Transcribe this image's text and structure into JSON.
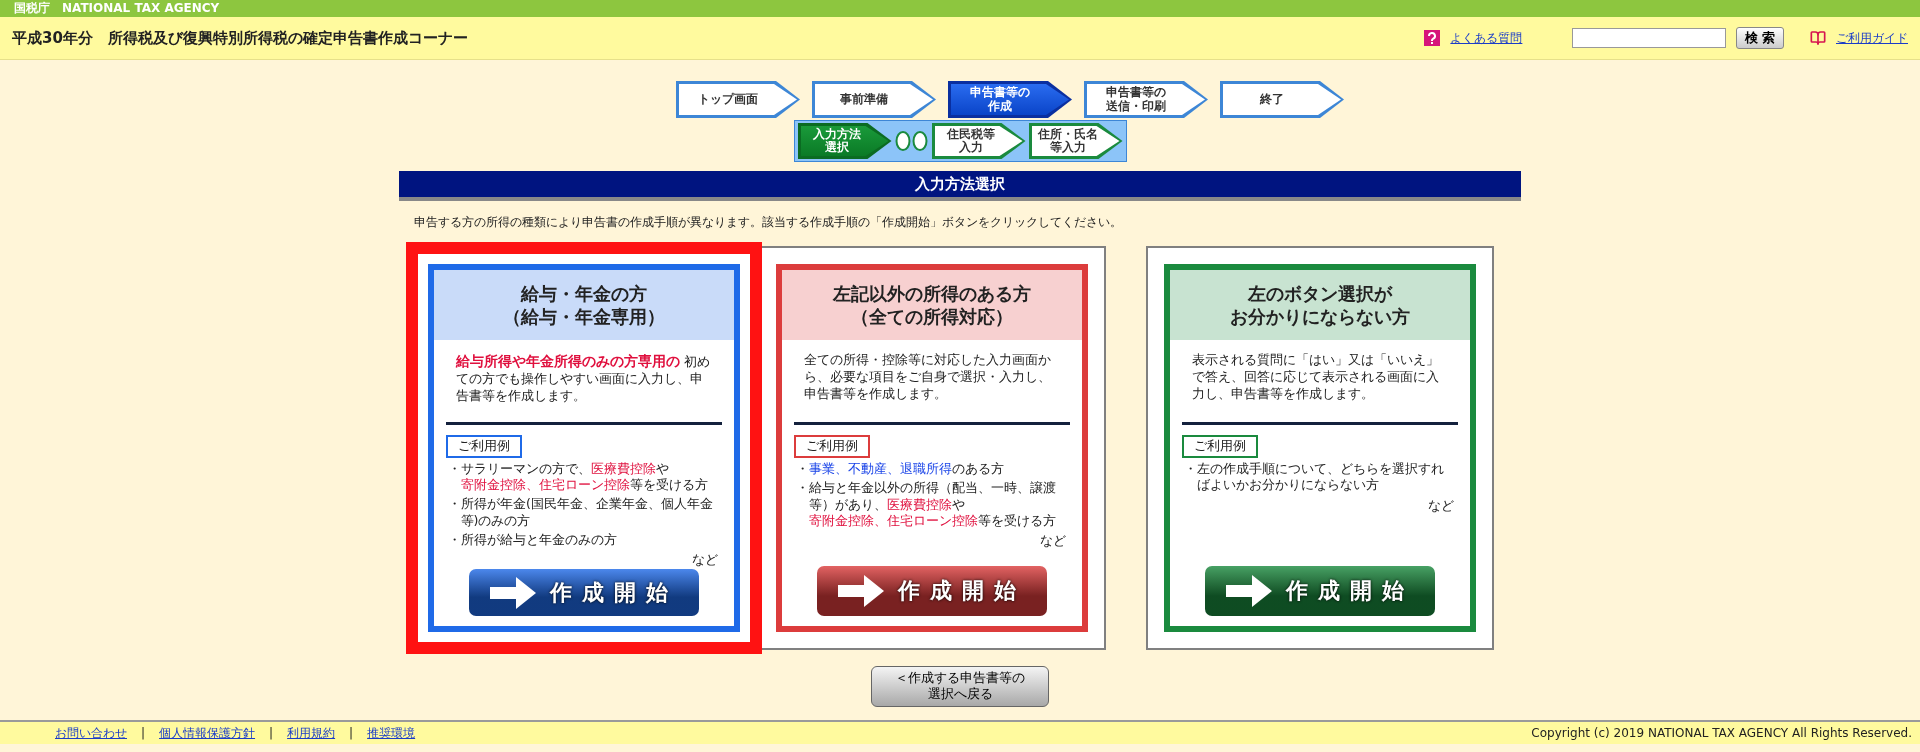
{
  "agency_bar": {
    "label": "国税庁　NATIONAL TAX AGENCY"
  },
  "header": {
    "title": "平成30年分　所得税及び復興特別所得税の確定申告書作成コーナー",
    "faq_link": "よくある質問",
    "search_button": "検 索",
    "guide_link": "ご利用ガイド"
  },
  "steps": [
    {
      "label": "トップ画面",
      "selected": false
    },
    {
      "label": "事前準備",
      "selected": false
    },
    {
      "label": [
        "申告書等の",
        "作成"
      ],
      "selected": true
    },
    {
      "label": [
        "申告書等の",
        "送信・印刷"
      ],
      "selected": false
    },
    {
      "label": "終了",
      "selected": false
    }
  ],
  "sub_steps": [
    {
      "label": [
        "入力方法",
        "選択"
      ],
      "selected": true
    },
    {
      "label": [
        "住民税等",
        "入力"
      ],
      "selected": false
    },
    {
      "label": [
        "住所・氏名",
        "等入力"
      ],
      "selected": false
    }
  ],
  "section_title": "入力方法選択",
  "instruction": "申告する方の所得の種類により申告書の作成手順が異なります。該当する作成手順の「作成開始」ボタンをクリックしてください。",
  "cards": [
    {
      "color": "#1f6ae8",
      "focused": true,
      "title": [
        "給与・年金の方",
        "（給与・年金専用）"
      ],
      "description": [
        {
          "text": "給与所得や年金所得のみの方専用の",
          "kind": "strong"
        },
        {
          "text": " 初めての方でも操作しやすい画面に入力し、申告書等を作成します。",
          "kind": "plain"
        }
      ],
      "examples_label": "ご利用例",
      "examples": [
        [
          {
            "text": "・サラリーマンの方で、",
            "kind": "plain"
          },
          {
            "text": "医療費控除",
            "kind": "red"
          },
          {
            "text": "や",
            "kind": "plain"
          },
          {
            "text": "寄附金控除、住宅ローン控除",
            "kind": "red"
          },
          {
            "text": "等を受ける方",
            "kind": "plain"
          }
        ],
        [
          {
            "text": "・所得が年金(国民年金、企業年金、個人年金等)のみの方",
            "kind": "plain"
          }
        ],
        [
          {
            "text": "・所得が給与と年金のみの方",
            "kind": "plain"
          }
        ]
      ],
      "etc": "など",
      "start_button": "作成開始"
    },
    {
      "color": "#dc3c3c",
      "focused": false,
      "title": [
        "左記以外の所得のある方",
        "（全ての所得対応）"
      ],
      "description": [
        {
          "text": "全ての所得・控除等に対応した入力画面から、必要な項目をご自身で選択・入力し、申告書等を作成します。",
          "kind": "plain"
        }
      ],
      "examples_label": "ご利用例",
      "examples": [
        [
          {
            "text": "・",
            "kind": "plain"
          },
          {
            "text": "事業、不動産、退職所得",
            "kind": "blue"
          },
          {
            "text": "のある方",
            "kind": "plain"
          }
        ],
        [
          {
            "text": "・給与と年金以外の所得（配当、一時、譲渡等）があり、",
            "kind": "plain"
          },
          {
            "text": "医療費控除",
            "kind": "red"
          },
          {
            "text": "や",
            "kind": "plain"
          },
          {
            "text": "寄附金控除、住宅ローン控除",
            "kind": "red"
          },
          {
            "text": "等を受ける方",
            "kind": "plain"
          }
        ]
      ],
      "etc": "など",
      "start_button": "作成開始"
    },
    {
      "color": "#1a8a3e",
      "focused": false,
      "title": [
        "左のボタン選択が",
        "お分かりにならない方"
      ],
      "description": [
        {
          "text": "表示される質問に「はい」又は「いいえ」で答え、回答に応じて表示される画面に入力し、申告書等を作成します。",
          "kind": "plain"
        }
      ],
      "examples_label": "ご利用例",
      "examples": [
        [
          {
            "text": "・左の作成手順について、どちらを選択すればよいかお分かりにならない方",
            "kind": "plain"
          }
        ]
      ],
      "etc": "など",
      "start_button": "作成開始"
    }
  ],
  "back_button": [
    "＜作成する申告書等の",
    "選択へ戻る"
  ],
  "footer": {
    "items": [
      {
        "text": "お問い合わせ",
        "kind": "link"
      },
      {
        "text": "|",
        "kind": "separator"
      },
      {
        "text": "個人情報保護方針",
        "kind": "link"
      },
      {
        "text": "|",
        "kind": "separator"
      },
      {
        "text": "利用規約",
        "kind": "link"
      },
      {
        "text": "|",
        "kind": "separator"
      },
      {
        "text": "推奨環境",
        "kind": "link"
      }
    ],
    "copyright": "Copyright (c) 2019 NATIONAL TAX AGENCY All Rights Reserved."
  }
}
